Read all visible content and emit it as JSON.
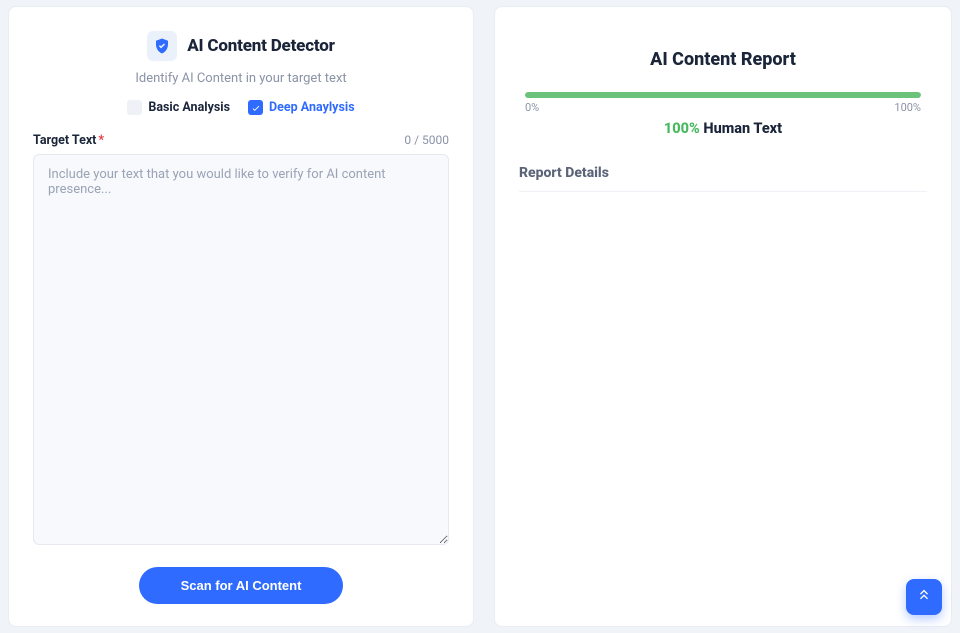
{
  "detector": {
    "title": "AI Content Detector",
    "subtitle": "Identify AI Content in your target text",
    "tabs": {
      "basic": {
        "label": "Basic Analysis",
        "checked": false
      },
      "deep": {
        "label": "Deep Anaylysis",
        "checked": true
      }
    },
    "target": {
      "label": "Target Text",
      "required": "*",
      "char_count": "0 / 5000",
      "placeholder": "Include your text that you would like to verify for AI content presence...",
      "value": ""
    },
    "scan_button": "Scan for AI Content"
  },
  "report": {
    "title": "AI Content Report",
    "progress": {
      "percent": 100,
      "min_label": "0%",
      "max_label": "100%",
      "bar_color": "#6ac27b"
    },
    "result": {
      "percent_text": "100%",
      "label": "Human Text"
    },
    "details_heading": "Report Details"
  },
  "icons": {
    "shield": "shield-check-icon",
    "scroll_top": "chevrons-up-icon"
  },
  "colors": {
    "accent": "#2f6bff",
    "success": "#47b960"
  }
}
